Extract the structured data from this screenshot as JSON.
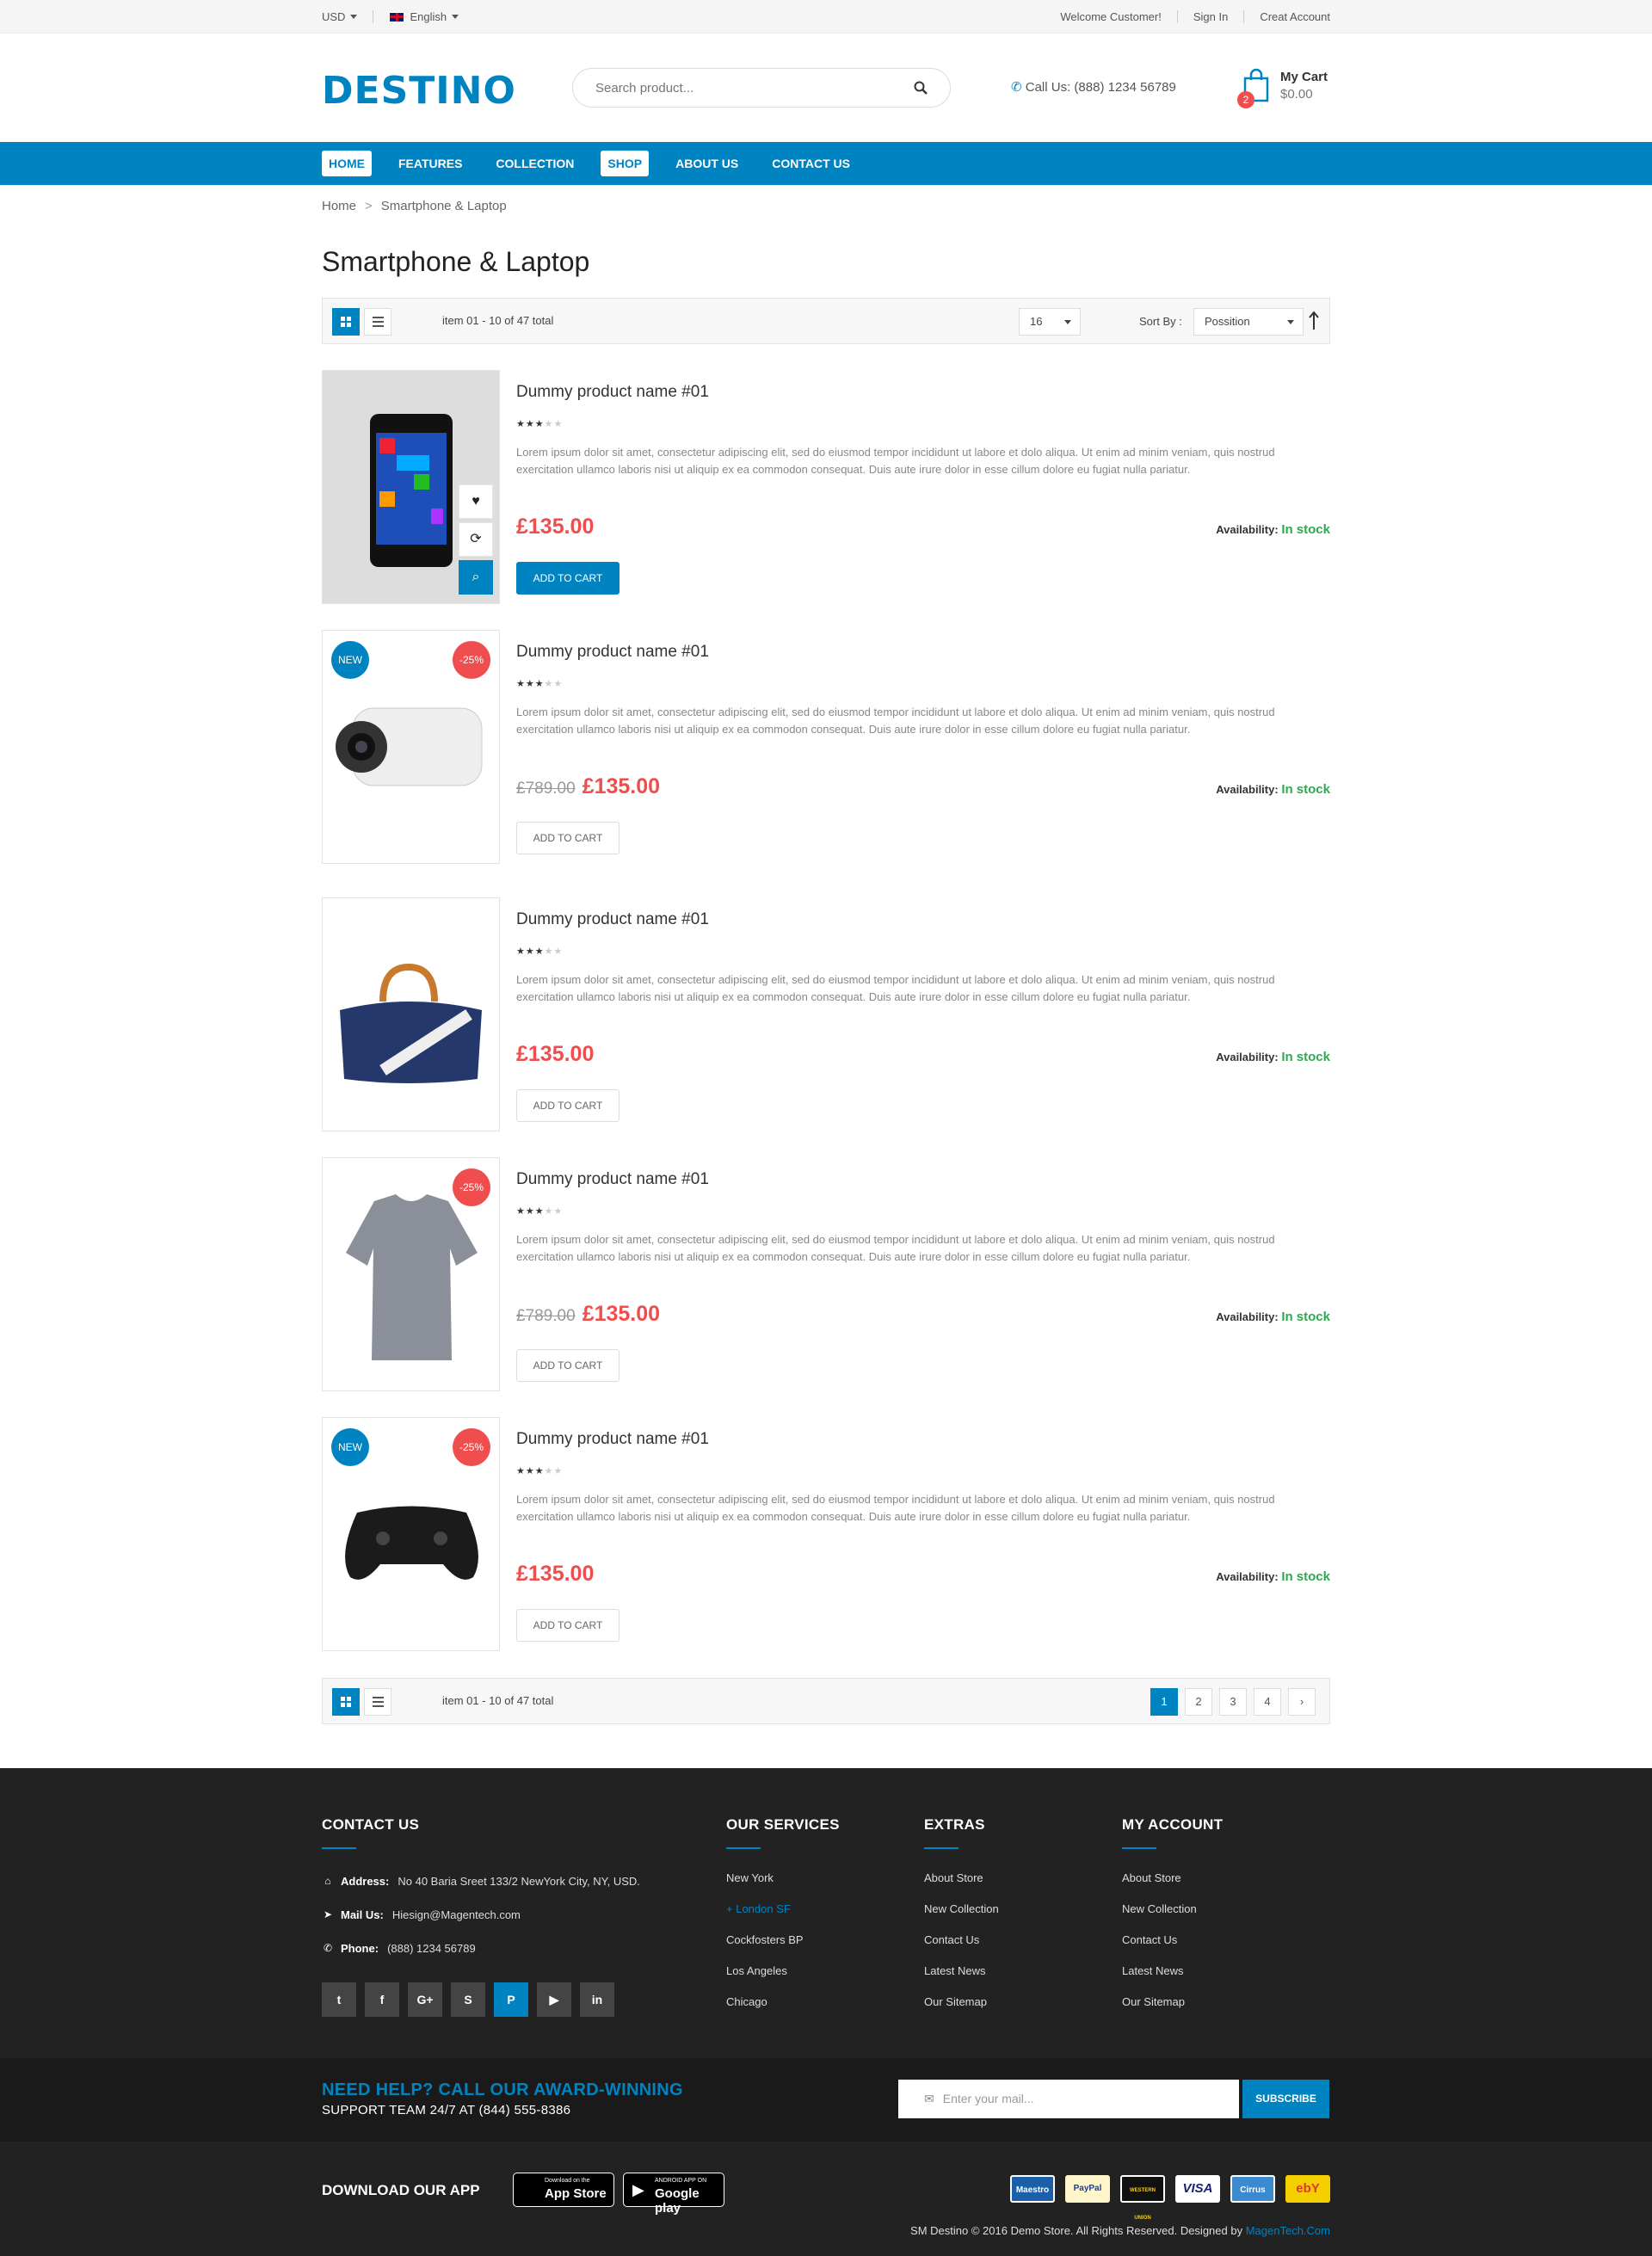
{
  "topbar": {
    "currency": "USD",
    "language": "English",
    "welcome": "Welcome Customer!",
    "sign_in": "Sign In",
    "create_account": "Creat Account"
  },
  "header": {
    "logo": "DESTINO",
    "search_placeholder": "Search product...",
    "call_label": "Call Us: (888) 1234 56789",
    "cart_title": "My Cart",
    "cart_total": "$0.00",
    "cart_count": "2"
  },
  "nav": [
    "HOME",
    "FEATURES",
    "COLLECTION",
    "SHOP",
    "ABOUT US",
    "CONTACT US"
  ],
  "breadcrumb": {
    "home": "Home",
    "current": "Smartphone & Laptop"
  },
  "page_title": "Smartphone & Laptop",
  "toolbar": {
    "count": "item 01 - 10 of 47 total",
    "limit": "16",
    "sort_label": "Sort By :",
    "sort_value": "Possition"
  },
  "pager": [
    "1",
    "2",
    "3",
    "4",
    "›"
  ],
  "products": [
    {
      "name": "Dummy product name #01",
      "rating": 3,
      "desc": "Lorem ipsum dolor sit amet, consectetur adipiscing elit, sed do eiusmod tempor incididunt ut labore et dolo aliqua. Ut enim ad minim veniam, quis nostrud exercitation ullamco laboris nisi ut aliquip ex ea commodon consequat. Duis aute irure dolor in esse cillum dolore eu fugiat nulla pariatur.",
      "old_price": "",
      "price": "£135.00",
      "availability_label": "Availability:",
      "availability": "In stock",
      "cta": "ADD TO CART",
      "badge_new": "",
      "badge_sale": ""
    },
    {
      "name": "Dummy product name #01",
      "rating": 3,
      "desc": "Lorem ipsum dolor sit amet, consectetur adipiscing elit, sed do eiusmod tempor incididunt ut labore et dolo aliqua. Ut enim ad minim veniam, quis nostrud exercitation ullamco laboris nisi ut aliquip ex ea commodon consequat. Duis aute irure dolor in esse cillum dolore eu fugiat nulla pariatur.",
      "old_price": "£789.00",
      "price": "£135.00",
      "availability_label": "Availability:",
      "availability": "In stock",
      "cta": "ADD TO CART",
      "badge_new": "NEW",
      "badge_sale": "-25%"
    },
    {
      "name": "Dummy product name #01",
      "rating": 3,
      "desc": "Lorem ipsum dolor sit amet, consectetur adipiscing elit, sed do eiusmod tempor incididunt ut labore et dolo aliqua. Ut enim ad minim veniam, quis nostrud exercitation ullamco laboris nisi ut aliquip ex ea commodon consequat. Duis aute irure dolor in esse cillum dolore eu fugiat nulla pariatur.",
      "old_price": "",
      "price": "£135.00",
      "availability_label": "Availability:",
      "availability": "In stock",
      "cta": "ADD TO CART",
      "badge_new": "",
      "badge_sale": ""
    },
    {
      "name": "Dummy product name #01",
      "rating": 3,
      "desc": "Lorem ipsum dolor sit amet, consectetur adipiscing elit, sed do eiusmod tempor incididunt ut labore et dolo aliqua. Ut enim ad minim veniam, quis nostrud exercitation ullamco laboris nisi ut aliquip ex ea commodon consequat. Duis aute irure dolor in esse cillum dolore eu fugiat nulla pariatur.",
      "old_price": "£789.00",
      "price": "£135.00",
      "availability_label": "Availability:",
      "availability": "In stock",
      "cta": "ADD TO CART",
      "badge_new": "",
      "badge_sale": "-25%"
    },
    {
      "name": "Dummy product name #01",
      "rating": 3,
      "desc": "Lorem ipsum dolor sit amet, consectetur adipiscing elit, sed do eiusmod tempor incididunt ut labore et dolo aliqua. Ut enim ad minim veniam, quis nostrud exercitation ullamco laboris nisi ut aliquip ex ea commodon consequat. Duis aute irure dolor in esse cillum dolore eu fugiat nulla pariatur.",
      "old_price": "",
      "price": "£135.00",
      "availability_label": "Availability:",
      "availability": "In stock",
      "cta": "ADD TO CART",
      "badge_new": "NEW",
      "badge_sale": "-25%"
    }
  ],
  "footer": {
    "contact_title": "CONTACT US",
    "address_label": "Address:",
    "address": "No 40 Baria Sreet 133/2 NewYork City, NY, USD.",
    "mail_label": "Mail Us:",
    "mail": "Hiesign@Magentech.com",
    "phone_label": "Phone:",
    "phone": "(888) 1234 56789",
    "socials": [
      "twitter",
      "facebook",
      "google-plus",
      "skype",
      "pinterest",
      "youtube",
      "linkedin"
    ],
    "services_title": "OUR SERVICES",
    "services": [
      "New York",
      "London SF",
      "Cockfosters BP",
      "Los Angeles",
      "Chicago"
    ],
    "extras_title": "EXTRAS",
    "extras": [
      "About Store",
      "New Collection",
      "Contact Us",
      "Latest News",
      "Our Sitemap"
    ],
    "account_title": "MY ACCOUNT",
    "account": [
      "About Store",
      "New Collection",
      "Contact Us",
      "Latest News",
      "Our Sitemap"
    ]
  },
  "help": {
    "line1": "NEED HELP? CALL OUR AWARD-WINNING",
    "line2": "SUPPORT TEAM 24/7 AT (844) 555-8386",
    "email_placeholder": "Enter your mail...",
    "subscribe": "SUBSCRIBE"
  },
  "bottom": {
    "download_title": "DOWNLOAD OUR APP",
    "appstore_small": "Download on the",
    "appstore": "App Store",
    "play_small": "ANDROID APP ON",
    "play": "Google play",
    "payments": [
      "Maestro",
      "PayPal",
      "WESTERN UNION",
      "VISA",
      "Cirrus",
      "ebY"
    ],
    "copyright": "SM Destino © 2016 Demo Store. All Rights Reserved. Designed by",
    "designer": "MagenTech.Com"
  },
  "colors": {
    "accent": "#0083c1",
    "sale": "#f04e4e",
    "in_stock": "#2fa84f",
    "footer_bg": "#222222"
  }
}
